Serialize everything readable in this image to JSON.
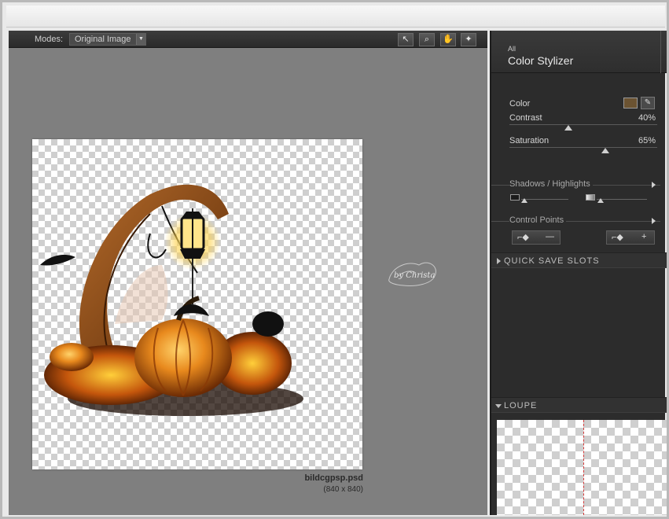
{
  "toolbar": {
    "modes_label": "Modes:",
    "modes_value": "Original Image",
    "tools": [
      {
        "name": "select-tool",
        "glyph": "↖"
      },
      {
        "name": "zoom-tool",
        "glyph": "🔍"
      },
      {
        "name": "hand-tool",
        "glyph": "✋"
      },
      {
        "name": "light-tool",
        "glyph": "✦"
      }
    ]
  },
  "document": {
    "filename": "bildcgpsp.psd",
    "dimensions": "(840 x 840)",
    "watermark": "by Christa"
  },
  "filter": {
    "category": "All",
    "name": "Color Stylizer",
    "color_label": "Color",
    "color_value": "#6b5332",
    "contrast_label": "Contrast",
    "contrast_value": "40%",
    "contrast_level": 0.4,
    "saturation_label": "Saturation",
    "saturation_value": "65%",
    "saturation_level": 0.65
  },
  "sections": {
    "shadows_highlights": "Shadows / Highlights",
    "control_points": "Control Points",
    "quick_save_slots": "QUICK SAVE SLOTS",
    "loupe": "LOUPE"
  },
  "control_points": {
    "remove_symbol": "—",
    "add_symbol": "+"
  }
}
